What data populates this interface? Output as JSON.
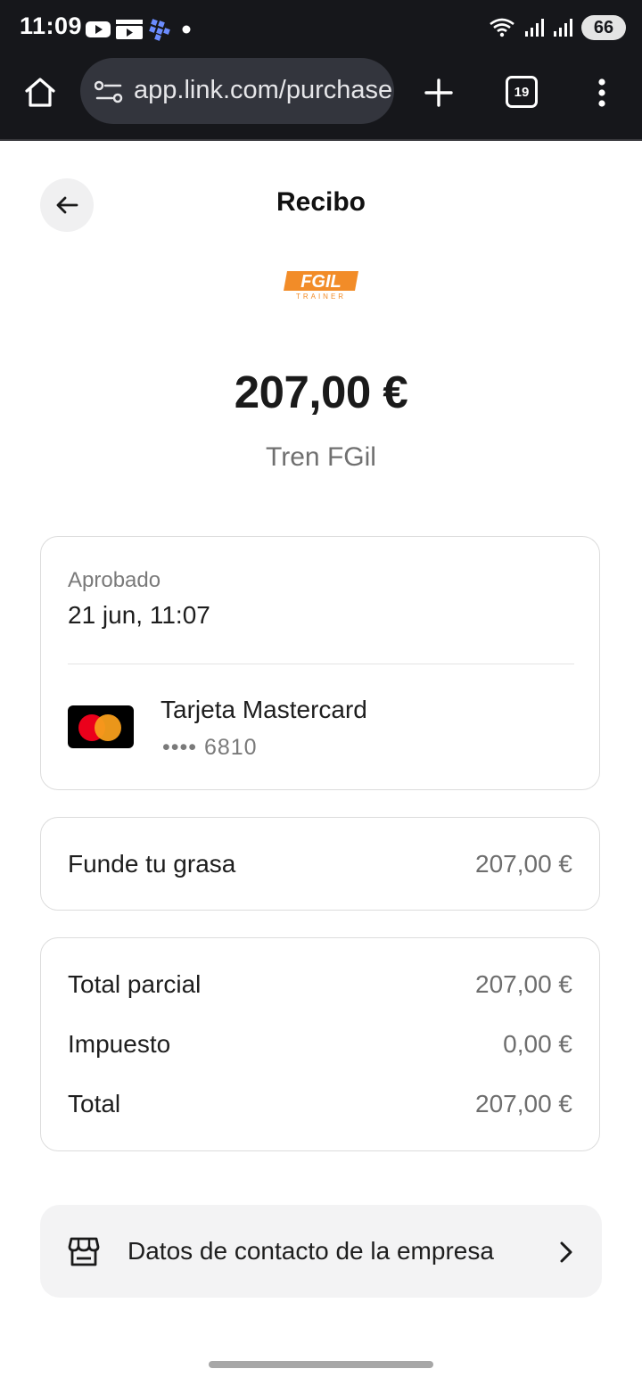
{
  "status_bar": {
    "time": "11:09",
    "battery": "66",
    "notification_icons": [
      "youtube-icon",
      "media-icon",
      "app-icon",
      "dot-icon"
    ],
    "signal_icons": [
      "wifi-icon",
      "signal-icon",
      "signal-icon"
    ]
  },
  "browser": {
    "url": "app.link.com/purchase",
    "tab_count": "19"
  },
  "page": {
    "title": "Recibo",
    "logo_alt": "FGIL",
    "amount": "207,00 €",
    "merchant": "Tren FGil"
  },
  "payment_card": {
    "status_label": "Aprobado",
    "date": "21 jun, 11:07",
    "card_name": "Tarjeta Mastercard",
    "card_last4": "•••• 6810"
  },
  "items": [
    {
      "name": "Funde tu grasa",
      "price": "207,00 €"
    }
  ],
  "totals": {
    "subtotal_label": "Total parcial",
    "subtotal_value": "207,00 €",
    "tax_label": "Impuesto",
    "tax_value": "0,00 €",
    "total_label": "Total",
    "total_value": "207,00 €"
  },
  "contact": {
    "label": "Datos de contacto de la empresa"
  },
  "colors": {
    "brand_orange": "#f28c28",
    "mastercard_red": "#eb001b",
    "mastercard_orange": "#f79e1b"
  }
}
